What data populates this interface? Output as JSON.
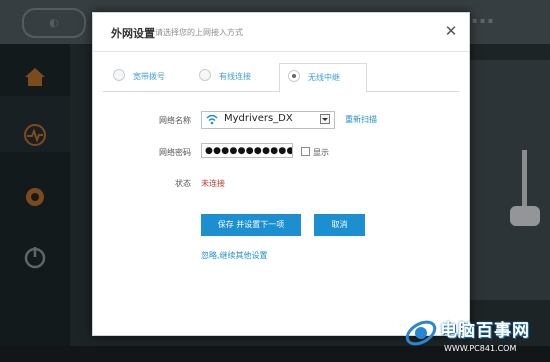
{
  "modal": {
    "title": "外网设置",
    "subtitle": "请选择您的上网接入方式",
    "close_glyph": "✕",
    "tabs": [
      {
        "label": "宽带拨号",
        "active": false
      },
      {
        "label": "有线连接",
        "active": false
      },
      {
        "label": "无线中继",
        "active": true
      }
    ],
    "form": {
      "ssid_label": "网络名称",
      "ssid_value": "Mydrivers_DX",
      "rescan_label": "重新扫描",
      "password_label": "网络密码",
      "password_value": "●●●●●●●●●●●●●",
      "show_label": "显示",
      "show_checked": false,
      "status_label": "状态",
      "status_value": "未连接"
    },
    "buttons": {
      "save": "保存 并设置下一项",
      "cancel": "取消"
    },
    "skip_link": "忽略,继续其他设置"
  },
  "watermark": {
    "title": "电脑百事网",
    "url": "WWW.PC841.COM"
  },
  "colors": {
    "accent": "#1b8fd0",
    "tab_text": "#3aa0d6",
    "status_error": "#c0392b",
    "overlay": "#000000"
  },
  "icons": {
    "wifi": "wifi-icon",
    "close": "close-icon",
    "dropdown": "chevron-down-icon"
  }
}
